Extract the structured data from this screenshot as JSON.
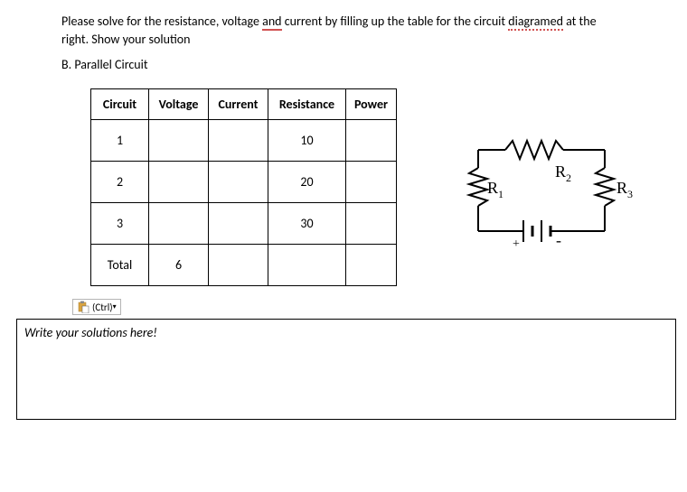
{
  "question": {
    "line1a": "Please solve for the resistance, voltage ",
    "and": "and",
    "line1b": " current by filling up the table for the circuit ",
    "diagramed": "diagramed",
    "line1c": " at the",
    "line2": "right. Show your solution"
  },
  "section": "B. Parallel Circuit",
  "table": {
    "headers": [
      "Circuit",
      "Voltage",
      "Current",
      "Resistance",
      "Power"
    ],
    "rows": [
      {
        "circuit": "1",
        "voltage": "",
        "current": "",
        "resistance": "10",
        "power": ""
      },
      {
        "circuit": "2",
        "voltage": "",
        "current": "",
        "resistance": "20",
        "power": ""
      },
      {
        "circuit": "3",
        "voltage": "",
        "current": "",
        "resistance": "30",
        "power": ""
      },
      {
        "circuit": "Total",
        "voltage": "6",
        "current": "",
        "resistance": "",
        "power": ""
      }
    ]
  },
  "diagram": {
    "labels": {
      "r1": "R",
      "r1sub": "1",
      "r2": "R",
      "r2sub": "2",
      "r3": "R",
      "r3sub": "3",
      "plus": "+",
      "minus": "-"
    }
  },
  "ctrl": {
    "label": "(Ctrl) ",
    "arrow": "▾"
  },
  "solution": {
    "placeholder": "Write your solutions here!"
  }
}
